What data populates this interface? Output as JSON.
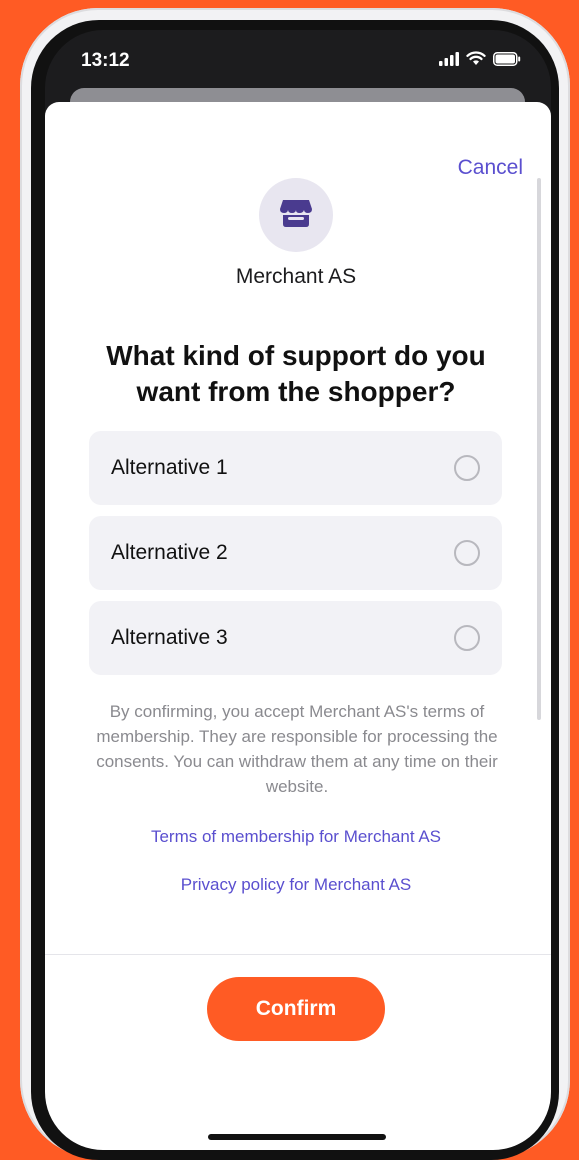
{
  "status_bar": {
    "time": "13:12",
    "icons": [
      "signal-icon",
      "wifi-icon",
      "battery-icon"
    ]
  },
  "sheet": {
    "cancel_label": "Cancel",
    "merchant_name": "Merchant AS",
    "question": "What kind of support do you want from the shopper?",
    "options": [
      {
        "label": "Alternative 1",
        "selected": false
      },
      {
        "label": "Alternative 2",
        "selected": false
      },
      {
        "label": "Alternative 3",
        "selected": false
      }
    ],
    "disclaimer": "By confirming, you accept Merchant AS's terms of membership. They are responsible for processing the consents. You can withdraw them at any time on their website.",
    "terms_link": "Terms of membership for Merchant AS",
    "privacy_link": "Privacy policy for Merchant AS",
    "confirm_label": "Confirm"
  },
  "colors": {
    "background": "#ff5b24",
    "accent": "#5a4fcf",
    "confirm_button": "#ff5b24",
    "option_background": "#f2f2f6"
  }
}
